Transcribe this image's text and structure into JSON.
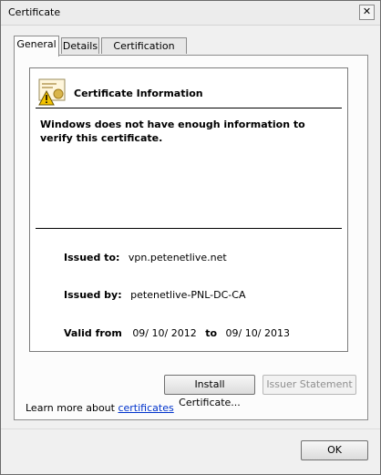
{
  "window": {
    "title": "Certificate",
    "close_glyph": "✕"
  },
  "tabs": [
    {
      "label": "General",
      "active": true
    },
    {
      "label": "Details",
      "active": false
    },
    {
      "label": "Certification Path",
      "active": false
    }
  ],
  "card": {
    "title": "Certificate Information",
    "warning": "Windows does not have enough information to verify this certificate.",
    "issued_to_label": "Issued to:",
    "issued_to_value": "vpn.petenetlive.net",
    "issued_by_label": "Issued by:",
    "issued_by_value": "petenetlive-PNL-DC-CA",
    "valid_from_label": "Valid from",
    "valid_from_value": "09/ 10/ 2012",
    "valid_to_label": "to",
    "valid_to_value": "09/ 10/ 2013"
  },
  "buttons": {
    "install": "Install Certificate...",
    "issuer_statement": "Issuer Statement",
    "ok": "OK"
  },
  "learn_more": {
    "prefix": "Learn more about",
    "link": "certificates"
  },
  "colors": {
    "link": "#0033cc",
    "certificate_icon_accent": "#d9b54a",
    "warning_icon": "#f2c200"
  },
  "icons": {
    "certificate": "certificate-warning-icon"
  }
}
